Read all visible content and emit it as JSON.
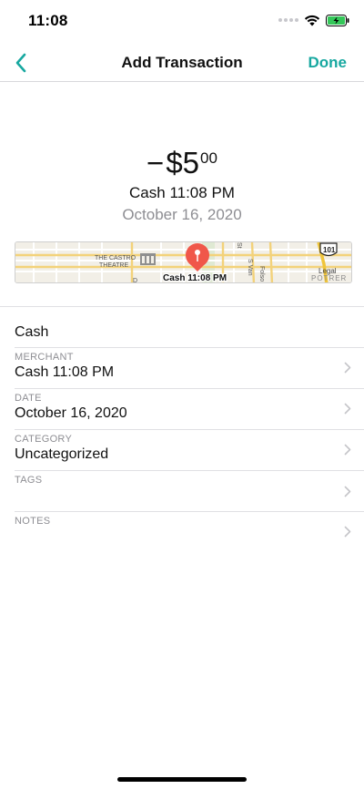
{
  "status_bar": {
    "time": "11:08"
  },
  "nav": {
    "title": "Add Transaction",
    "done_label": "Done",
    "accent_color": "#17a8a0"
  },
  "transaction": {
    "sign": "−",
    "currency": "$",
    "amount_whole": "5",
    "amount_cents": "00",
    "name": "Cash 11:08 PM",
    "date": "October 16, 2020"
  },
  "map": {
    "pin_label": "Cash 11:08 PM",
    "place_labels": [
      "THE CASTRO",
      "THEATRE",
      "Folso",
      "S Van",
      "St",
      "D",
      "Legal",
      "POTRER",
      "101"
    ]
  },
  "form": {
    "account": "Cash",
    "fields": [
      {
        "label": "MERCHANT",
        "value": "Cash 11:08 PM"
      },
      {
        "label": "DATE",
        "value": "October 16, 2020"
      },
      {
        "label": "CATEGORY",
        "value": "Uncategorized"
      },
      {
        "label": "TAGS",
        "value": ""
      },
      {
        "label": "NOTES",
        "value": ""
      }
    ]
  }
}
